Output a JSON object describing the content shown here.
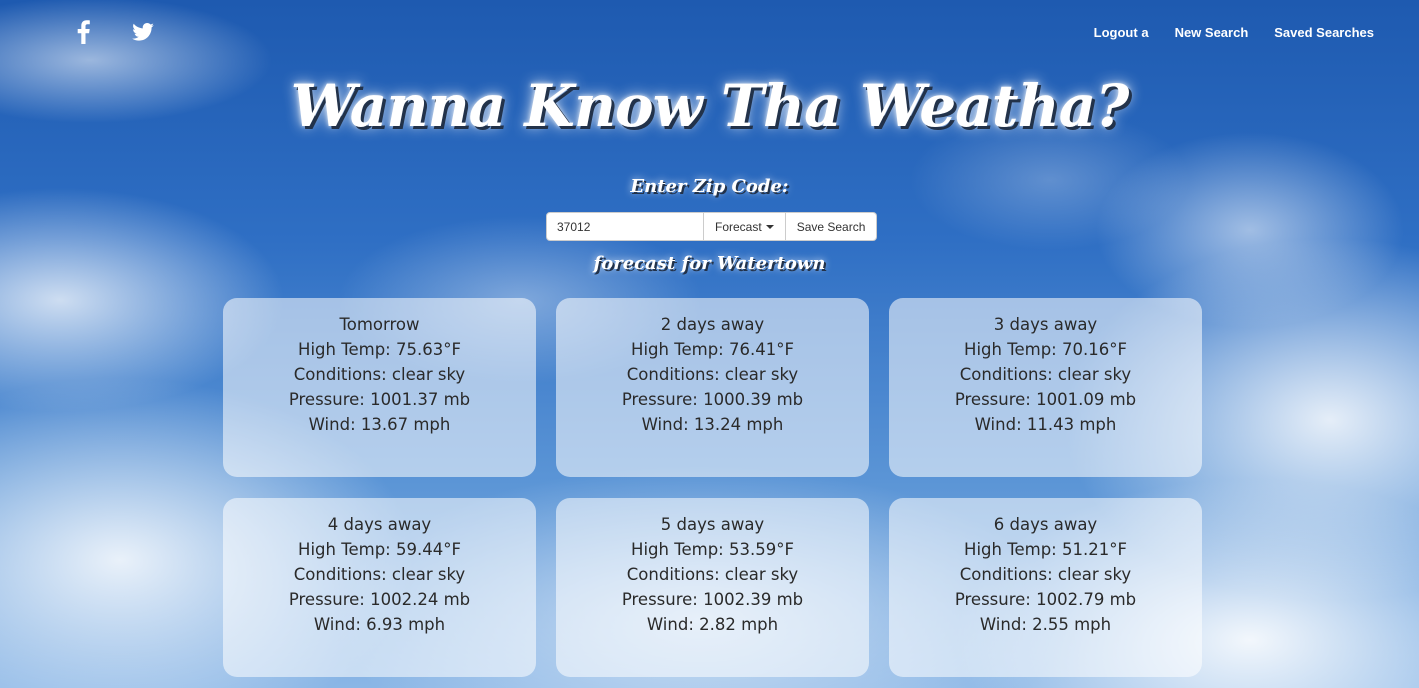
{
  "nav": {
    "social": [
      {
        "icon": "facebook-icon"
      },
      {
        "icon": "twitter-icon"
      }
    ],
    "links": [
      "Logout a",
      "New Search",
      "Saved Searches"
    ]
  },
  "header": {
    "title": "Wanna Know Tha Weatha?",
    "zip_label": "Enter Zip Code:"
  },
  "search": {
    "zip_value": "37012",
    "mode_label": "Forecast",
    "save_label": "Save Search"
  },
  "forecast": {
    "heading": "forecast for Watertown",
    "days": [
      {
        "day": "Tomorrow",
        "high": "High Temp: 75.63°F",
        "conditions": "Conditions: clear sky",
        "pressure": "Pressure: 1001.37 mb",
        "wind": "Wind: 13.67 mph"
      },
      {
        "day": "2 days away",
        "high": "High Temp: 76.41°F",
        "conditions": "Conditions: clear sky",
        "pressure": "Pressure: 1000.39 mb",
        "wind": "Wind: 13.24 mph"
      },
      {
        "day": "3 days away",
        "high": "High Temp: 70.16°F",
        "conditions": "Conditions: clear sky",
        "pressure": "Pressure: 1001.09 mb",
        "wind": "Wind: 11.43 mph"
      },
      {
        "day": "4 days away",
        "high": "High Temp: 59.44°F",
        "conditions": "Conditions: clear sky",
        "pressure": "Pressure: 1002.24 mb",
        "wind": "Wind: 6.93 mph"
      },
      {
        "day": "5 days away",
        "high": "High Temp: 53.59°F",
        "conditions": "Conditions: clear sky",
        "pressure": "Pressure: 1002.39 mb",
        "wind": "Wind: 2.82 mph"
      },
      {
        "day": "6 days away",
        "high": "High Temp: 51.21°F",
        "conditions": "Conditions: clear sky",
        "pressure": "Pressure: 1002.79 mb",
        "wind": "Wind: 2.55 mph"
      }
    ]
  }
}
